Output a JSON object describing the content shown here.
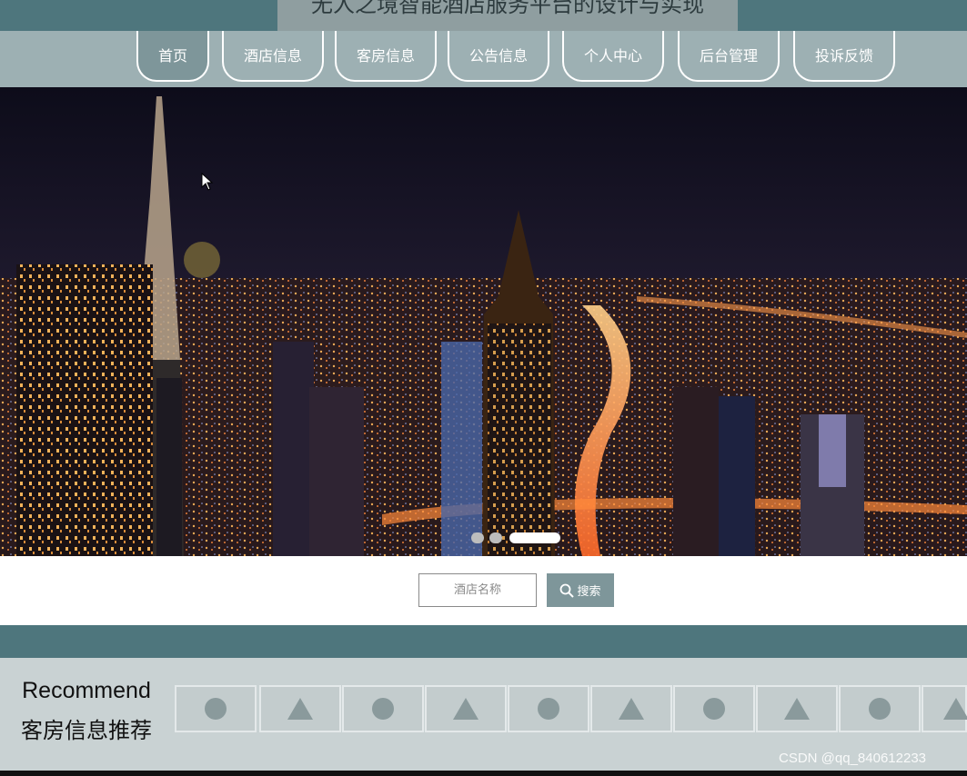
{
  "header": {
    "title": "无人之境智能酒店服务平台的设计与实现"
  },
  "nav": {
    "items": [
      {
        "label": "首页",
        "active": true
      },
      {
        "label": "酒店信息"
      },
      {
        "label": "客房信息"
      },
      {
        "label": "公告信息"
      },
      {
        "label": "个人中心"
      },
      {
        "label": "后台管理"
      },
      {
        "label": "投诉反馈"
      }
    ]
  },
  "carousel": {
    "slide_count": 3,
    "active_index": 2
  },
  "search": {
    "placeholder": "酒店名称",
    "button_label": "搜索",
    "button_icon": "search-icon"
  },
  "recommend": {
    "title_en": "Recommend",
    "title_cn": "客房信息推荐",
    "thumbnails": [
      "circle",
      "triangle",
      "circle",
      "triangle",
      "circle",
      "triangle",
      "circle",
      "triangle",
      "circle",
      "triangle"
    ]
  },
  "watermark": "CSDN @qq_840612233",
  "colors": {
    "teal": "#4e767d",
    "nav_bg": "#9db0b3",
    "accent": "#7e969a",
    "panel": "#c9d2d3"
  }
}
